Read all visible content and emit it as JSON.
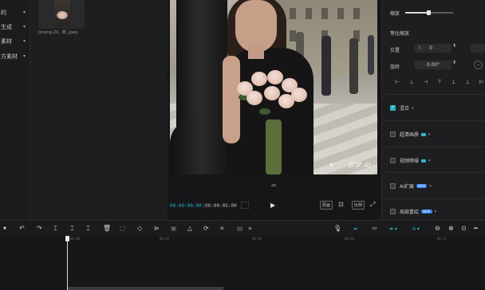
{
  "left_nav": {
    "items": [
      {
        "label": "的"
      },
      {
        "label": "生成"
      },
      {
        "label": "素材"
      },
      {
        "label": "方素材"
      }
    ]
  },
  "media": {
    "asset_name": "jimeng-20...数..jpeg"
  },
  "preview": {
    "watermark": "即梦 AI",
    "current_time": "00:00:00:00",
    "total_time": "00:00:05:00",
    "chip_original": "原画",
    "chip_ratio": "比例"
  },
  "properties": {
    "scale_label": "缩放",
    "uniform_scale_label": "等比缩放",
    "position_label": "位置",
    "position_x_axis": "X",
    "position_x_value": "0",
    "rotation_label": "旋转",
    "rotation_value": "0.00°",
    "features": [
      {
        "label": "混合",
        "checked": true
      },
      {
        "label": "超清画质",
        "checked": false
      },
      {
        "label": "视频降噪",
        "checked": false
      },
      {
        "label": "AI扩展",
        "checked": false
      },
      {
        "label": "局部重绘",
        "checked": false
      }
    ],
    "badge_new": "NEW",
    "badge_new2": "NEW",
    "accent_color": "#1fb2c4"
  },
  "timeline": {
    "ruler_labels": [
      "00:00",
      "00:02",
      "00:04",
      "00:06",
      "00:08",
      "00:10",
      "00:12"
    ]
  }
}
